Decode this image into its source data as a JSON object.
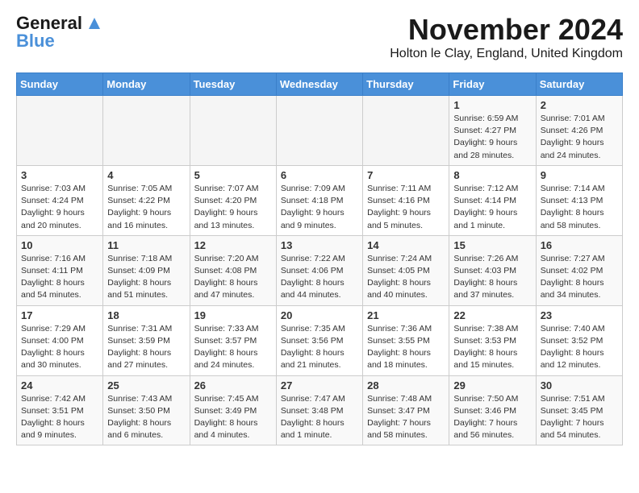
{
  "logo": {
    "general": "General",
    "blue": "Blue"
  },
  "title": "November 2024",
  "subtitle": "Holton le Clay, England, United Kingdom",
  "weekdays": [
    "Sunday",
    "Monday",
    "Tuesday",
    "Wednesday",
    "Thursday",
    "Friday",
    "Saturday"
  ],
  "weeks": [
    [
      {
        "day": "",
        "info": ""
      },
      {
        "day": "",
        "info": ""
      },
      {
        "day": "",
        "info": ""
      },
      {
        "day": "",
        "info": ""
      },
      {
        "day": "",
        "info": ""
      },
      {
        "day": "1",
        "info": "Sunrise: 6:59 AM\nSunset: 4:27 PM\nDaylight: 9 hours and 28 minutes."
      },
      {
        "day": "2",
        "info": "Sunrise: 7:01 AM\nSunset: 4:26 PM\nDaylight: 9 hours and 24 minutes."
      }
    ],
    [
      {
        "day": "3",
        "info": "Sunrise: 7:03 AM\nSunset: 4:24 PM\nDaylight: 9 hours and 20 minutes."
      },
      {
        "day": "4",
        "info": "Sunrise: 7:05 AM\nSunset: 4:22 PM\nDaylight: 9 hours and 16 minutes."
      },
      {
        "day": "5",
        "info": "Sunrise: 7:07 AM\nSunset: 4:20 PM\nDaylight: 9 hours and 13 minutes."
      },
      {
        "day": "6",
        "info": "Sunrise: 7:09 AM\nSunset: 4:18 PM\nDaylight: 9 hours and 9 minutes."
      },
      {
        "day": "7",
        "info": "Sunrise: 7:11 AM\nSunset: 4:16 PM\nDaylight: 9 hours and 5 minutes."
      },
      {
        "day": "8",
        "info": "Sunrise: 7:12 AM\nSunset: 4:14 PM\nDaylight: 9 hours and 1 minute."
      },
      {
        "day": "9",
        "info": "Sunrise: 7:14 AM\nSunset: 4:13 PM\nDaylight: 8 hours and 58 minutes."
      }
    ],
    [
      {
        "day": "10",
        "info": "Sunrise: 7:16 AM\nSunset: 4:11 PM\nDaylight: 8 hours and 54 minutes."
      },
      {
        "day": "11",
        "info": "Sunrise: 7:18 AM\nSunset: 4:09 PM\nDaylight: 8 hours and 51 minutes."
      },
      {
        "day": "12",
        "info": "Sunrise: 7:20 AM\nSunset: 4:08 PM\nDaylight: 8 hours and 47 minutes."
      },
      {
        "day": "13",
        "info": "Sunrise: 7:22 AM\nSunset: 4:06 PM\nDaylight: 8 hours and 44 minutes."
      },
      {
        "day": "14",
        "info": "Sunrise: 7:24 AM\nSunset: 4:05 PM\nDaylight: 8 hours and 40 minutes."
      },
      {
        "day": "15",
        "info": "Sunrise: 7:26 AM\nSunset: 4:03 PM\nDaylight: 8 hours and 37 minutes."
      },
      {
        "day": "16",
        "info": "Sunrise: 7:27 AM\nSunset: 4:02 PM\nDaylight: 8 hours and 34 minutes."
      }
    ],
    [
      {
        "day": "17",
        "info": "Sunrise: 7:29 AM\nSunset: 4:00 PM\nDaylight: 8 hours and 30 minutes."
      },
      {
        "day": "18",
        "info": "Sunrise: 7:31 AM\nSunset: 3:59 PM\nDaylight: 8 hours and 27 minutes."
      },
      {
        "day": "19",
        "info": "Sunrise: 7:33 AM\nSunset: 3:57 PM\nDaylight: 8 hours and 24 minutes."
      },
      {
        "day": "20",
        "info": "Sunrise: 7:35 AM\nSunset: 3:56 PM\nDaylight: 8 hours and 21 minutes."
      },
      {
        "day": "21",
        "info": "Sunrise: 7:36 AM\nSunset: 3:55 PM\nDaylight: 8 hours and 18 minutes."
      },
      {
        "day": "22",
        "info": "Sunrise: 7:38 AM\nSunset: 3:53 PM\nDaylight: 8 hours and 15 minutes."
      },
      {
        "day": "23",
        "info": "Sunrise: 7:40 AM\nSunset: 3:52 PM\nDaylight: 8 hours and 12 minutes."
      }
    ],
    [
      {
        "day": "24",
        "info": "Sunrise: 7:42 AM\nSunset: 3:51 PM\nDaylight: 8 hours and 9 minutes."
      },
      {
        "day": "25",
        "info": "Sunrise: 7:43 AM\nSunset: 3:50 PM\nDaylight: 8 hours and 6 minutes."
      },
      {
        "day": "26",
        "info": "Sunrise: 7:45 AM\nSunset: 3:49 PM\nDaylight: 8 hours and 4 minutes."
      },
      {
        "day": "27",
        "info": "Sunrise: 7:47 AM\nSunset: 3:48 PM\nDaylight: 8 hours and 1 minute."
      },
      {
        "day": "28",
        "info": "Sunrise: 7:48 AM\nSunset: 3:47 PM\nDaylight: 7 hours and 58 minutes."
      },
      {
        "day": "29",
        "info": "Sunrise: 7:50 AM\nSunset: 3:46 PM\nDaylight: 7 hours and 56 minutes."
      },
      {
        "day": "30",
        "info": "Sunrise: 7:51 AM\nSunset: 3:45 PM\nDaylight: 7 hours and 54 minutes."
      }
    ]
  ]
}
